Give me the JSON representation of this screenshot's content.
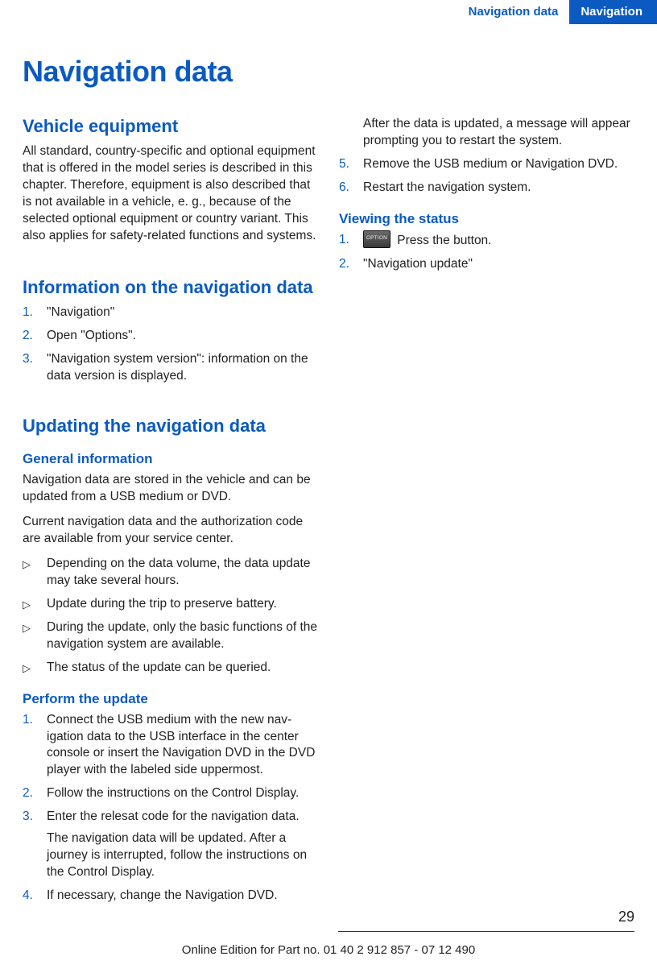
{
  "header": {
    "section": "Navigation data",
    "chapter": "Navigation"
  },
  "title": "Navigation data",
  "s1": {
    "h": "Vehicle equipment",
    "p": "All standard, country-specific and optional equipment that is offered in the model series is described in this chapter. Therefore, equipment is also described that is not available in a vehicle, e. g., because of the selected optional equip­ment or country variant. This also applies for safety-related functions and systems."
  },
  "s2": {
    "h": "Information on the navigation data",
    "li1": "\"Navigation\"",
    "li2": "Open \"Options\".",
    "li3": "\"Navigation system version\": information on the data version is displayed."
  },
  "s3": {
    "h": "Updating the navigation data",
    "gen": {
      "h": "General information",
      "p1": "Navigation data are stored in the vehicle and can be updated from a USB medium or DVD.",
      "p2": "Current navigation data and the authorization code are available from your service center.",
      "b1": "Depending on the data volume, the data up­date may take several hours.",
      "b2": "Update during the trip to preserve battery.",
      "b3": "During the update, only the basic functions of the navigation system are available.",
      "b4": "The status of the update can be queried."
    },
    "perf": {
      "h": "Perform the update",
      "li1": "Connect the USB medium with the new nav­igation data to the USB interface in the cen­ter console or insert the Navigation DVD in the DVD player with the labeled side upper­most.",
      "li2": "Follow the instructions on the Control Dis­play.",
      "li3": "Enter the relesat code for the navigation data.",
      "li3b": "The navigation data will be updated. After a journey is interrupted, follow the instruc­tions on the Control Display.",
      "li4": "If necessary, change the Navigation DVD.",
      "li4b": "After the data is updated, a message will ap­pear prompting you to restart the system.",
      "li5": "Remove the USB medium or Navigation DVD.",
      "li6": "Restart the navigation system."
    },
    "view": {
      "h": "Viewing the status",
      "li1": " Press the button.",
      "li2": "\"Navigation update\""
    }
  },
  "footer": {
    "page": "29",
    "text": "Online Edition for Part no. 01 40 2 912 857 - 07 12 490"
  }
}
